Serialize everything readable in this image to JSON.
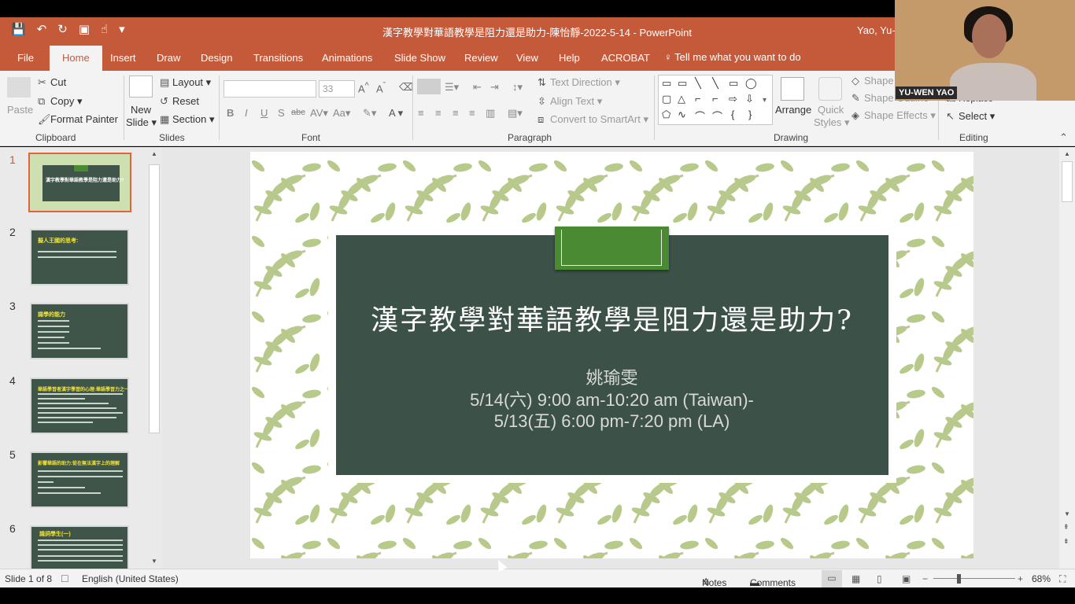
{
  "title_bar": {
    "document_title": "漢字教學對華語教學是阻力還是助力-陳怡靜-2022-5-14  -  PowerPoint",
    "user": "Yao, Yu-w"
  },
  "tabs": [
    "File",
    "Home",
    "Insert",
    "Draw",
    "Design",
    "Transitions",
    "Animations",
    "Slide Show",
    "Review",
    "View",
    "Help",
    "ACROBAT"
  ],
  "active_tab": "Home",
  "tell_me": "Tell me what you want to do",
  "ribbon": {
    "clipboard": {
      "paste": "Paste",
      "cut": "Cut",
      "copy": "Copy",
      "format_painter": "Format Painter",
      "label": "Clipboard"
    },
    "slides": {
      "new_slide_1": "New",
      "new_slide_2": "Slide",
      "layout": "Layout",
      "reset": "Reset",
      "section": "Section",
      "label": "Slides"
    },
    "font": {
      "size": "33",
      "label": "Font"
    },
    "paragraph": {
      "text_direction": "Text Direction",
      "align_text": "Align Text",
      "convert": "Convert to SmartArt",
      "label": "Paragraph"
    },
    "drawing": {
      "arrange": "Arrange",
      "quick_styles_1": "Quick",
      "quick_styles_2": "Styles",
      "shape_fill": "Shape",
      "shape_outline": "Shape Outline",
      "shape_effects": "Shape Effects",
      "label": "Drawing"
    },
    "editing": {
      "replace": "Replace",
      "select": "Select",
      "label": "Editing"
    }
  },
  "thumbnails": [
    {
      "num": "1",
      "title": "漢字教學對華語教學是阻力還是助力?"
    },
    {
      "num": "2",
      "title": "擬人王國的思考:"
    },
    {
      "num": "3",
      "title": "識學的能力"
    },
    {
      "num": "4",
      "title": "華語學習者漢字學習的心理:華語學習力之一"
    },
    {
      "num": "5",
      "title": "影響華語的助力:從在無法漢字上的理解"
    },
    {
      "num": "6",
      "title": "識詞學生(一)"
    }
  ],
  "slide": {
    "title": "漢字教學對華語教學是阻力還是助力?",
    "presenter": "姚瑜雯",
    "line1": "5/14(六) 9:00 am-10:20 am (Taiwan)-",
    "line2": "5/13(五) 6:00 pm-7:20 pm (LA)"
  },
  "status_bar": {
    "slide_counter": "Slide 1 of 8",
    "language": "English (United States)",
    "notes": "Notes",
    "comments": "Comments",
    "zoom": "68%"
  },
  "webcam": {
    "name": "YU-WEN YAO"
  },
  "colors": {
    "accent": "#c55a3a",
    "slide_board": "#3c5148",
    "leaf": "#b7c98b"
  }
}
